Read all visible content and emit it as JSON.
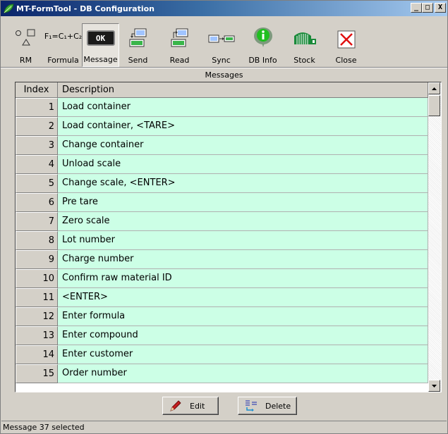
{
  "window": {
    "title": "MT-FormTool - DB Configuration",
    "minimize_glyph": "_",
    "maximize_glyph": "□",
    "close_glyph": "X"
  },
  "toolbar": {
    "items": [
      {
        "label": "RM",
        "icon": "shapes-icon"
      },
      {
        "label": "Formula",
        "icon": "formula-icon",
        "icon_text": "F₁=C₁+C₂"
      },
      {
        "label": "Message",
        "icon": "ok-message-icon",
        "icon_text": "OK",
        "selected": true
      },
      {
        "label": "Send",
        "icon": "send-icon"
      },
      {
        "label": "Read",
        "icon": "read-icon"
      },
      {
        "label": "Sync",
        "icon": "sync-icon"
      },
      {
        "label": "DB Info",
        "icon": "info-icon"
      },
      {
        "label": "Stock",
        "icon": "stock-icon"
      },
      {
        "label": "Close",
        "icon": "close-icon"
      }
    ]
  },
  "section_title": "Messages",
  "table": {
    "columns": [
      "Index",
      "Description"
    ],
    "rows": [
      {
        "index": "1",
        "description": "Load container"
      },
      {
        "index": "2",
        "description": "Load container, <TARE>"
      },
      {
        "index": "3",
        "description": "Change container"
      },
      {
        "index": "4",
        "description": "Unload scale"
      },
      {
        "index": "5",
        "description": "Change scale, <ENTER>"
      },
      {
        "index": "6",
        "description": "Pre tare"
      },
      {
        "index": "7",
        "description": "Zero scale"
      },
      {
        "index": "8",
        "description": "Lot number"
      },
      {
        "index": "9",
        "description": "Charge number"
      },
      {
        "index": "10",
        "description": "Confirm raw material ID"
      },
      {
        "index": "11",
        "description": "<ENTER>"
      },
      {
        "index": "12",
        "description": "Enter formula"
      },
      {
        "index": "13",
        "description": "Enter compound"
      },
      {
        "index": "14",
        "description": "Enter customer"
      },
      {
        "index": "15",
        "description": "Order number"
      }
    ]
  },
  "buttons": {
    "edit": "Edit",
    "delete": "Delete"
  },
  "status": "Message 37 selected",
  "colors": {
    "row_bg": "#ccffe6",
    "titlebar_start": "#0a246a",
    "titlebar_end": "#a6caf0",
    "chrome": "#d4d0c8"
  }
}
